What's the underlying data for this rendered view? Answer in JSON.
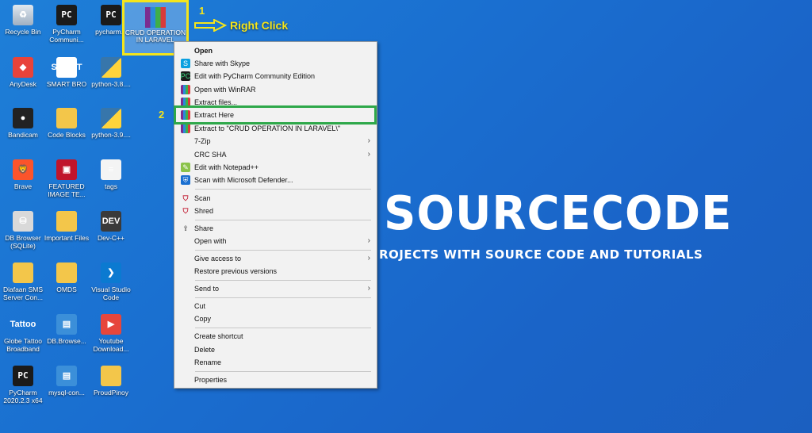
{
  "desktop_icons": [
    {
      "id": "recycle",
      "label": "Recycle Bin",
      "icon": "recycle-bin-icon",
      "glyph": "♻"
    },
    {
      "id": "pycharm1",
      "label": "PyCharm Communi...",
      "icon": "pycharm-icon",
      "glyph": "PC"
    },
    {
      "id": "pycharm2",
      "label": "pycharm...",
      "icon": "pycharm-icon",
      "glyph": "PC"
    },
    {
      "id": "anydesk",
      "label": "AnyDesk",
      "icon": "anydesk-icon",
      "glyph": "◆"
    },
    {
      "id": "smartbro",
      "label": "SMART BRO",
      "icon": "smart-bro-icon",
      "glyph": "SMART"
    },
    {
      "id": "python38",
      "label": "python-3.8....",
      "icon": "python-icon",
      "glyph": ""
    },
    {
      "id": "bandicam",
      "label": "Bandicam",
      "icon": "bandicam-icon",
      "glyph": "●"
    },
    {
      "id": "codeblocks",
      "label": "Code Blocks",
      "icon": "folder-icon",
      "glyph": ""
    },
    {
      "id": "python39",
      "label": "python-3.9....",
      "icon": "python-icon",
      "glyph": ""
    },
    {
      "id": "brave",
      "label": "Brave",
      "icon": "brave-icon",
      "glyph": "🦁"
    },
    {
      "id": "featured",
      "label": "FEATURED IMAGE TE...",
      "icon": "featured-image-icon",
      "glyph": "▣"
    },
    {
      "id": "tags",
      "label": "tags",
      "icon": "document-icon",
      "glyph": "≡"
    },
    {
      "id": "dbbrowser",
      "label": "DB Browser (SQLite)",
      "icon": "database-icon",
      "glyph": "⛁"
    },
    {
      "id": "important",
      "label": "Important Files",
      "icon": "folder-icon",
      "glyph": ""
    },
    {
      "id": "devcpp",
      "label": "Dev-C++",
      "icon": "devcpp-icon",
      "glyph": "DEV"
    },
    {
      "id": "diafaan",
      "label": "Diafaan SMS Server Con...",
      "icon": "folder-icon",
      "glyph": ""
    },
    {
      "id": "omds",
      "label": "OMDS",
      "icon": "folder-icon",
      "glyph": ""
    },
    {
      "id": "vscode",
      "label": "Visual Studio Code",
      "icon": "vscode-icon",
      "glyph": "❯"
    },
    {
      "id": "globe",
      "label": "Globe Tattoo Broadband",
      "icon": "globe-tattoo-icon",
      "glyph": "Tattoo"
    },
    {
      "id": "dbbrowse2",
      "label": "DB.Browse...",
      "icon": "network-shortcut-icon",
      "glyph": "▤"
    },
    {
      "id": "youtube",
      "label": "Youtube Download...",
      "icon": "youtube-downloader-icon",
      "glyph": "▶"
    },
    {
      "id": "pycharm3",
      "label": "PyCharm 2020.2.3 x64",
      "icon": "pycharm-icon",
      "glyph": "PC"
    },
    {
      "id": "mysql",
      "label": "mysql-con...",
      "icon": "network-shortcut-icon",
      "glyph": "▤"
    },
    {
      "id": "proudpinoy",
      "label": "ProudPinoy",
      "icon": "folder-icon",
      "glyph": ""
    }
  ],
  "selected_file": {
    "label": "CRUD OPERATION IN LARAVEL",
    "icon": "winrar-archive-icon"
  },
  "annotations": {
    "step1": "1",
    "step2": "2",
    "right_click": "Right Click"
  },
  "background": {
    "brand": "SOURCECODE",
    "tagline": "ROJECTS WITH SOURCE CODE AND TUTORIALS"
  },
  "context_menu": {
    "items": [
      {
        "id": "open",
        "label": "Open",
        "icon": "",
        "bold": true,
        "submenu": false
      },
      {
        "id": "skype",
        "label": "Share with Skype",
        "icon": "skype-icon",
        "submenu": false
      },
      {
        "id": "pycharm",
        "label": "Edit with PyCharm Community Edition",
        "icon": "pycharm-icon",
        "submenu": false
      },
      {
        "id": "winrar",
        "label": "Open with WinRAR",
        "icon": "winrar-icon",
        "submenu": false
      },
      {
        "id": "extractfiles",
        "label": "Extract files...",
        "icon": "winrar-icon",
        "submenu": false
      },
      {
        "id": "extracthere",
        "label": "Extract Here",
        "icon": "winrar-icon",
        "submenu": false
      },
      {
        "id": "extractto",
        "label": "Extract to \"CRUD OPERATION IN LARAVEL\\\"",
        "icon": "winrar-icon",
        "submenu": false
      },
      {
        "id": "7zip",
        "label": "7-Zip",
        "icon": "",
        "submenu": true
      },
      {
        "id": "crcsha",
        "label": "CRC SHA",
        "icon": "",
        "submenu": true
      },
      {
        "id": "notepadpp",
        "label": "Edit with Notepad++",
        "icon": "notepad-plus-plus-icon",
        "submenu": false
      },
      {
        "id": "defender",
        "label": "Scan with Microsoft Defender...",
        "icon": "defender-icon",
        "submenu": false
      },
      {
        "id": "scan",
        "label": "Scan",
        "icon": "mcafee-icon",
        "submenu": false
      },
      {
        "id": "shred",
        "label": "Shred",
        "icon": "mcafee-icon",
        "submenu": false
      },
      {
        "id": "share",
        "label": "Share",
        "icon": "share-icon",
        "submenu": false
      },
      {
        "id": "openwith",
        "label": "Open with",
        "icon": "",
        "submenu": true
      },
      {
        "id": "giveaccess",
        "label": "Give access to",
        "icon": "",
        "submenu": true
      },
      {
        "id": "restore",
        "label": "Restore previous versions",
        "icon": "",
        "submenu": false
      },
      {
        "id": "sendto",
        "label": "Send to",
        "icon": "",
        "submenu": true
      },
      {
        "id": "cut",
        "label": "Cut",
        "icon": "",
        "submenu": false
      },
      {
        "id": "copy",
        "label": "Copy",
        "icon": "",
        "submenu": false
      },
      {
        "id": "createshortcut",
        "label": "Create shortcut",
        "icon": "",
        "submenu": false
      },
      {
        "id": "delete",
        "label": "Delete",
        "icon": "",
        "submenu": false
      },
      {
        "id": "rename",
        "label": "Rename",
        "icon": "",
        "submenu": false
      },
      {
        "id": "properties",
        "label": "Properties",
        "icon": "",
        "submenu": false
      }
    ]
  },
  "colors": {
    "highlight_yellow": "#f5e51b",
    "highlight_green": "#2ea84a",
    "desktop_blue": "#1a6fd0"
  }
}
